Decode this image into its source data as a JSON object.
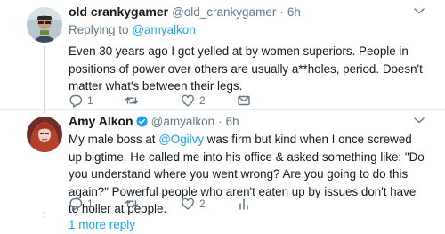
{
  "tweets": [
    {
      "display_name": "old crankygamer",
      "handle": "@old_crankygamer",
      "separator": "·",
      "time": "6h",
      "replying_prefix": "Replying to",
      "replying_to": "@amyalkon",
      "text": "Even 30 years ago I got yelled at by women superiors.  People in positions of power over others are usually a**holes, period.   Doesn't matter what's between their legs.",
      "reply_count": "1",
      "retweet_count": "",
      "like_count": "2"
    },
    {
      "display_name": "Amy Alkon",
      "handle": "@amyalkon",
      "separator": "·",
      "time": "6h",
      "verified": true,
      "text_before": "My male boss at ",
      "mention": "@Ogilvy",
      "text_after": " was firm but kind when I once screwed up bigtime. He called me into his office & asked something like: \"Do you understand where you went wrong? Are you going to do this again?\" Powerful people who aren't eaten up by issues don't have to holler at people.",
      "reply_count": "1",
      "retweet_count": "",
      "like_count": "2"
    }
  ],
  "more_replies": "1 more reply",
  "icons": [
    "reply-icon",
    "retweet-icon",
    "like-icon",
    "dm-icon",
    "analytics-icon",
    "caret-down-icon",
    "verified-icon"
  ],
  "colors": {
    "link": "#1da1f2",
    "muted": "#657786",
    "text": "#14171a",
    "line": "#ccd6dd"
  }
}
